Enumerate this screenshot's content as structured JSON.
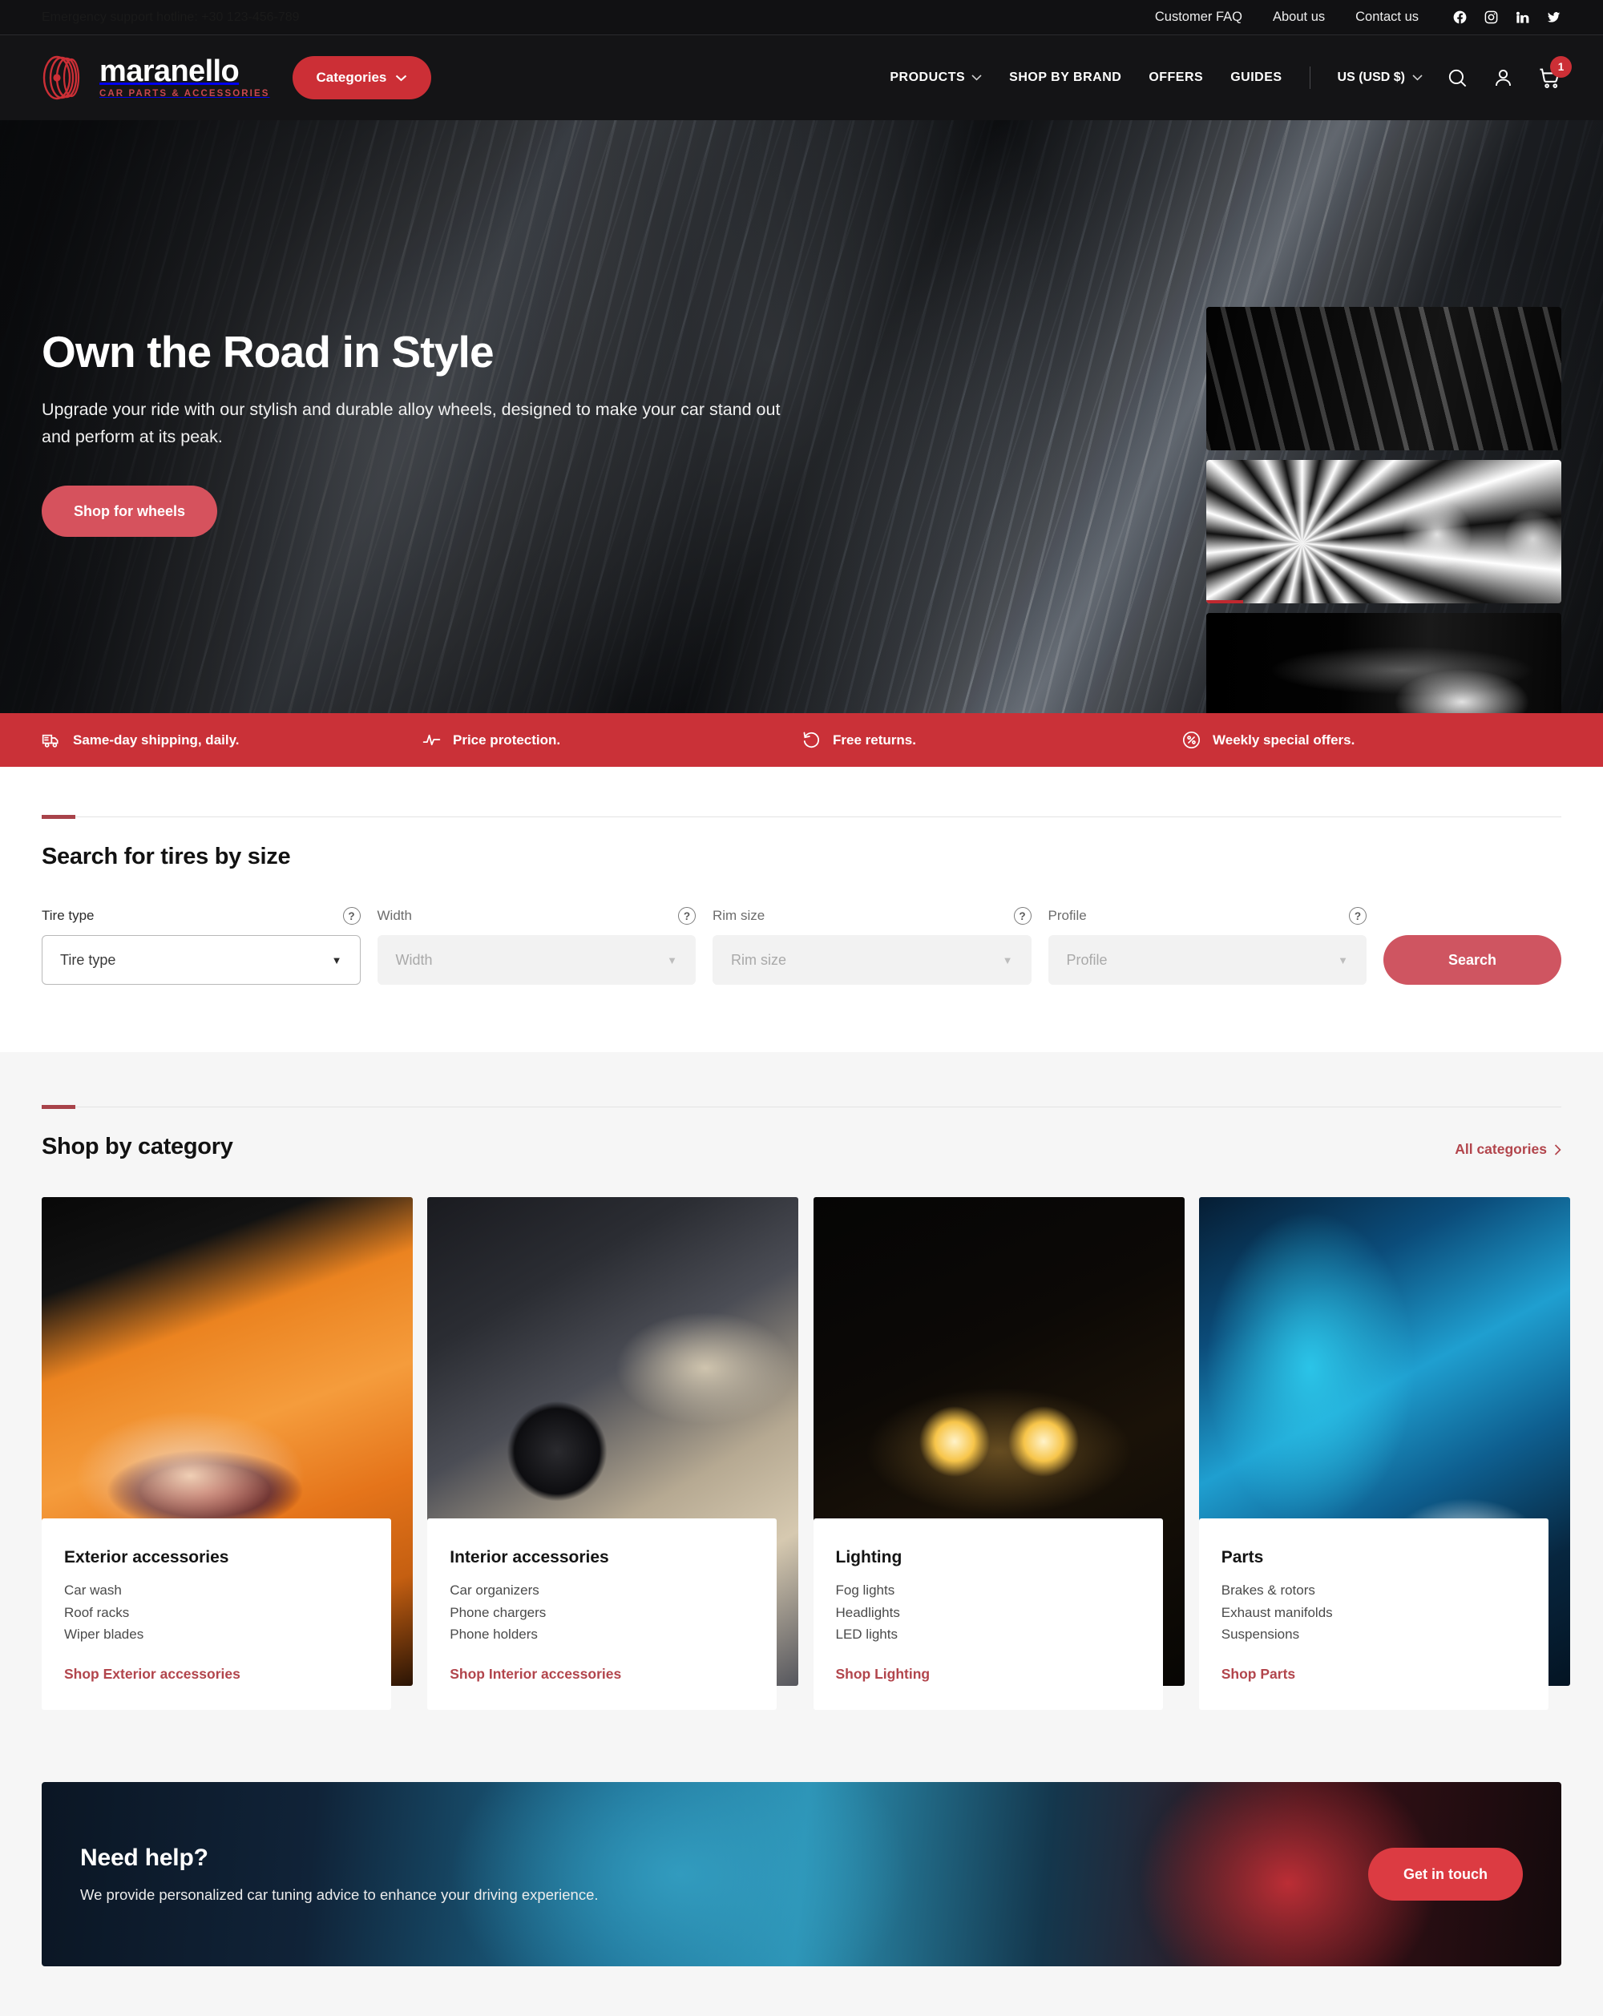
{
  "topbar": {
    "phone": "Emergency support hotline: +30 123-456-789",
    "links": [
      {
        "label": "Customer FAQ",
        "name": "customer-faq"
      },
      {
        "label": "About us",
        "name": "about-us"
      },
      {
        "label": "Contact us",
        "name": "contact-us"
      }
    ],
    "social": [
      {
        "name": "facebook-icon"
      },
      {
        "name": "instagram-icon"
      },
      {
        "name": "linkedin-icon"
      },
      {
        "name": "twitter-icon"
      }
    ]
  },
  "header": {
    "brand_name": "maranello",
    "brand_tagline": "CAR PARTS & ACCESSORIES",
    "categories_label": "Categories",
    "nav": [
      {
        "label": "PRODUCTS",
        "has_caret": true
      },
      {
        "label": "SHOP BY BRAND",
        "has_caret": false
      },
      {
        "label": "OFFERS",
        "has_caret": false
      },
      {
        "label": "GUIDES",
        "has_caret": false
      }
    ],
    "currency": "US (USD $)",
    "cart_count": "1"
  },
  "hero": {
    "title": "Own the Road in Style",
    "subtitle": "Upgrade your ride with our stylish and durable alloy wheels, designed to make your car stand out and perform at its peak.",
    "cta_label": "Shop for wheels",
    "gallery": [
      {
        "name": "thumb-tire-tread",
        "alt": "Close-up of tire tread"
      },
      {
        "name": "thumb-alloy-wheels",
        "alt": "Alloy wheel rims",
        "active": true
      },
      {
        "name": "thumb-headlight",
        "alt": "Car headlight"
      }
    ]
  },
  "benefits": [
    {
      "icon": "truck-icon",
      "label": "Same-day shipping, daily."
    },
    {
      "icon": "pulse-icon",
      "label": "Price protection."
    },
    {
      "icon": "return-arrow-icon",
      "label": "Free returns."
    },
    {
      "icon": "percent-badge-icon",
      "label": "Weekly special offers."
    }
  ],
  "tire_search": {
    "title": "Search for tires by size",
    "fields": [
      {
        "label": "Tire type",
        "placeholder": "Tire type",
        "state": "active",
        "help": "?"
      },
      {
        "label": "Width",
        "placeholder": "Width",
        "state": "disabled",
        "help": "?"
      },
      {
        "label": "Rim size",
        "placeholder": "Rim size",
        "state": "disabled",
        "help": "?"
      },
      {
        "label": "Profile",
        "placeholder": "Profile",
        "state": "disabled",
        "help": "?"
      }
    ],
    "search_label": "Search"
  },
  "categories_section": {
    "title": "Shop by category",
    "all_link": "All categories",
    "cards": [
      {
        "title": "Exterior accessories",
        "items": [
          "Car wash",
          "Roof racks",
          "Wiper blades"
        ],
        "shop_label": "Shop Exterior accessories",
        "photo": "orange-sports-car-taillight"
      },
      {
        "title": "Interior accessories",
        "items": [
          "Car organizers",
          "Phone chargers",
          "Phone holders"
        ],
        "shop_label": "Shop Interior accessories",
        "photo": "car-interior-steering-wheel"
      },
      {
        "title": "Lighting",
        "items": [
          "Fog lights",
          "Headlights",
          "LED lights"
        ],
        "shop_label": "Shop Lighting",
        "photo": "glowing-headlight-rings"
      },
      {
        "title": "Parts",
        "items": [
          "Brakes & rotors",
          "Exhaust manifolds",
          "Suspensions"
        ],
        "shop_label": "Shop Parts",
        "photo": "blue-car-body-panel"
      }
    ]
  },
  "help_banner": {
    "title": "Need help?",
    "subtitle": "We provide personalized car tuning advice to enhance your driving experience.",
    "button_label": "Get in touch"
  },
  "colors": {
    "brand_red": "#cc2f36",
    "muted_red": "#cf5561",
    "link_red": "#b2454c",
    "benefits_bar": "#ca3138",
    "dark": "#141416"
  }
}
